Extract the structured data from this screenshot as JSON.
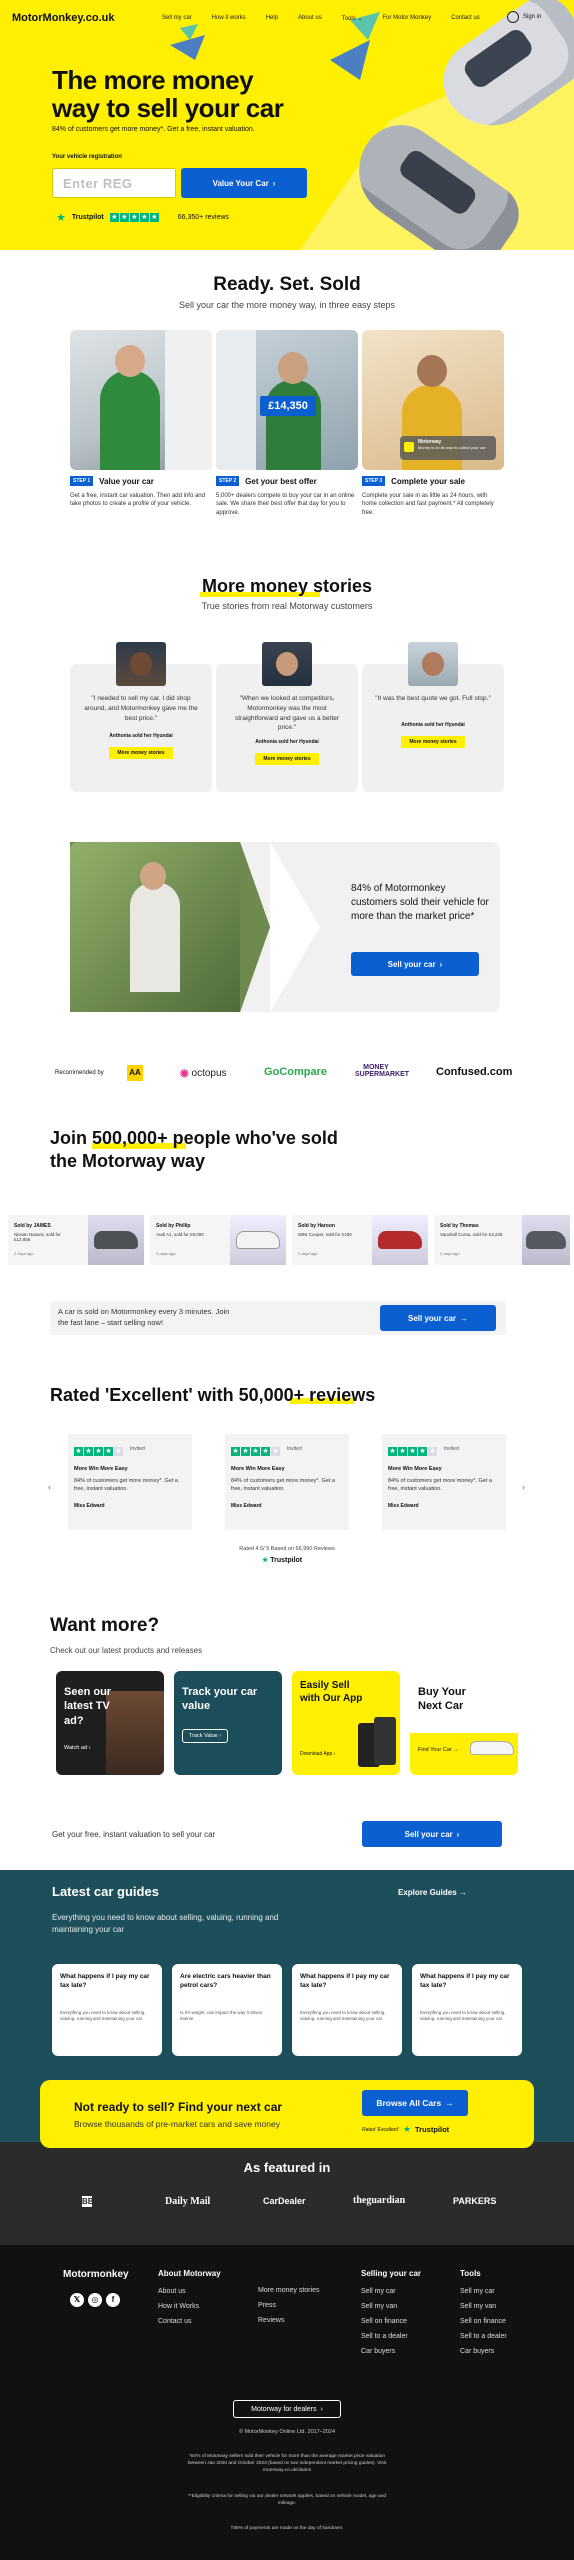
{
  "header": {
    "logo": "MotorMonkey.co.uk",
    "nav": [
      "Sell my car",
      "How it works",
      "Help",
      "About us",
      "Tools",
      "For Motor Monkey",
      "Contact us"
    ],
    "signin": "Sign in"
  },
  "hero": {
    "title_line1": "The more money",
    "title_line2": "way to sell your car",
    "subtitle": "84% of customers get more money*. Get a free, instant valuation.",
    "reg_label": "Your vehicle registration",
    "reg_placeholder": "Enter REG",
    "cta": "Value Your Car",
    "tp_brand": "Trustpilot",
    "tp_reviews": "66,350+ reviews"
  },
  "steps": {
    "title": "Ready. Set. Sold",
    "subtitle": "Sell your car the more money way, in three easy steps",
    "items": [
      {
        "tag": "STEP 1",
        "title": "Value your car",
        "text": "Get a free, instant car valuation. Then add info and take photos to create a profile of your vehicle."
      },
      {
        "tag": "STEP 2",
        "title": "Get your best offer",
        "text": "5,000+ dealers compete to buy your car in an online sale. We share their best offer that day for you to approve.",
        "badge": "£14,350"
      },
      {
        "tag": "STEP 3",
        "title": "Complete your sale",
        "text": "Complete your sale in as little as 24 hours, with home collection and fast payment.* All completely free.",
        "notice_title": "Motorway",
        "notice_text": "Money is on its way to collect your car"
      }
    ]
  },
  "stories": {
    "title": "More money stories",
    "subtitle": "True stories from real Motorway customers",
    "items": [
      {
        "quote": "\"I needed to sell my car. I did shop around, and Motormonkey gave me the best price.\"",
        "who": "Anthonia sold her Hyundai",
        "btn": "More money stories"
      },
      {
        "quote": "\"When we looked at competitors, Motormonkey was the most straightforward and gave us a better price.\"",
        "who": "Anthonia sold her Hyundai",
        "btn": "More money stories"
      },
      {
        "quote": "\"It was the best quote we got. Full stop.\"",
        "who": "Anthonia sold her Hyundai",
        "btn": "More money stories"
      }
    ]
  },
  "promo": {
    "text": "84% of Motormonkey customers sold their vehicle for more than the market price*",
    "cta": "Sell your car"
  },
  "recommended": {
    "label": "Recommended by",
    "brands": [
      "AA",
      "octopus",
      "GoCompare",
      "MONEY SUPERMARKET",
      "Confused.com"
    ]
  },
  "join": {
    "title_line1": "Join 500,000+ people who've sold",
    "title_line2": "the Motorway way",
    "sold": [
      {
        "by": "Sold by JAMES",
        "car": "Nissan Navara, sold for £12,856",
        "when": "2 days ago"
      },
      {
        "by": "Sold by Phillip",
        "car": "Audi A1, sold for £9,000",
        "when": "2 days ago"
      },
      {
        "by": "Sold by Haroon",
        "car": "MINI Cooper, sold for £190",
        "when": "2 days ago"
      },
      {
        "by": "Sold by Thomas",
        "car": "Vauxhall Corsa, sold for £3,226",
        "when": "2 days ago"
      }
    ],
    "banner_text": "A car is sold on Motormonkey every 3 minutes. Join the fast lane – start selling now!",
    "banner_cta": "Sell your car"
  },
  "reviews": {
    "title": "Rated 'Excellent' with 50,000+ reviews",
    "items": [
      {
        "tag": "Invited",
        "head": "More Win More Easy",
        "body": "84% of customers get more money*. Get a free, instant valuation.",
        "name": "Miss Edward"
      },
      {
        "tag": "Invited",
        "head": "More Win More Easy",
        "body": "84% of customers get more money*. Get a free, instant valuation.",
        "name": "Miss Edward"
      },
      {
        "tag": "Invited",
        "head": "More Win More Easy",
        "body": "84% of customers get more money*. Get a free, instant valuation.",
        "name": "Miss Edward"
      }
    ],
    "rated": "Rated 4.5/ 5 Based on 66,990 Reviews",
    "tp": "Trustpilot"
  },
  "more": {
    "title": "Want more?",
    "subtitle": "Check out our latest products and releases",
    "tiles": [
      {
        "title": "Seen our latest TV ad?",
        "btn": "Watch ad"
      },
      {
        "title": "Track your car value",
        "btn": "Track Value"
      },
      {
        "title": "Easily Sell with Our App",
        "btn": "Download App"
      },
      {
        "title": "Buy Your Next Car",
        "btn": "Find Your Car"
      }
    ],
    "val_text": "Get your free, instant valuation to sell your car",
    "val_cta": "Sell your car"
  },
  "guides": {
    "title": "Latest car guides",
    "explore": "Explore Guides",
    "subtitle": "Everything you need to know about selling, valuing, running and maintaining your car",
    "items": [
      {
        "title": "What happens if I pay my car tax late?",
        "text": "Everything you need to know about selling, valuing, running and maintaining your car"
      },
      {
        "title": "Are electric cars heavier than petrol cars?",
        "text": "Is it's weight, can impact the way it drives interior"
      },
      {
        "title": "What happens if I pay my car tax late?",
        "text": "Everything you need to know about selling, valuing, running and maintaining your car"
      },
      {
        "title": "What happens if I pay my car tax late?",
        "text": "Everything you need to know about selling, valuing, running and maintaining your car"
      }
    ]
  },
  "buy": {
    "title": "Not ready to sell? Find your next car",
    "subtitle": "Browse thousands of pre-market cars and save money",
    "cta": "Browse All Cars",
    "rated": "Rated 'Excellent'",
    "tp": "Trustpilot"
  },
  "featured": {
    "title": "As featured in",
    "brands": [
      "BBC",
      "Daily Mail",
      "CarDealer",
      "theguardian",
      "PARKERS"
    ]
  },
  "footer": {
    "logo": "Motormonkey",
    "col1_title": "About Motorway",
    "col1": [
      "About us",
      "How it Works",
      "Contact us"
    ],
    "col2": [
      "More money stories",
      "Press",
      "Reviews"
    ],
    "col3_title": "Selling your car",
    "col3": [
      "Sell my car",
      "Sell my van",
      "Sell on finance",
      "Sell to a dealer",
      "Car buyers"
    ],
    "col4_title": "Tools",
    "col4": [
      "Sell my car",
      "Sell my van",
      "Sell on finance",
      "Sell to a dealer",
      "Car buyers"
    ],
    "dealers": "Motorway for dealers",
    "copyright": "© MotorMonkey Online Ltd. 2017–2024",
    "note1": "*84% of Motorway sellers sold their vehicle for more than the average market price valuation between Jan 2020 and October 2023 (based on two independent market pricing guides). Visit motorway.co.uk/claims",
    "note2": "**Eligibility criteria for selling via our dealer network applies, based on vehicle model, age and mileage.",
    "note3": "†85% of payments are made on the day of handover."
  }
}
